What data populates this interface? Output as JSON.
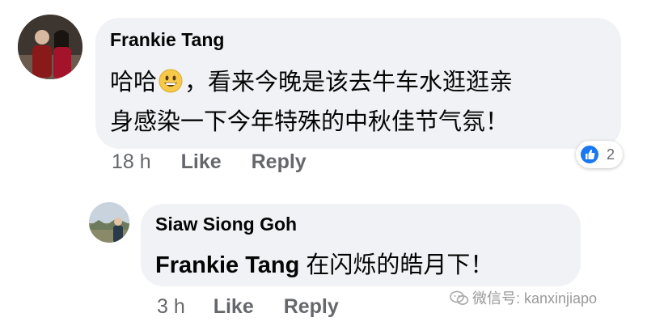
{
  "comment": {
    "author": "Frankie Tang",
    "text_line1_before_emoji": "哈哈",
    "text_line1_after_emoji": "，看来今晚是该去牛车水逛逛亲",
    "text_line2": "身感染一下今年特殊的中秋佳节气氛！",
    "time": "18 h",
    "like_label": "Like",
    "reply_label": "Reply",
    "reaction_count": "2",
    "emoji_icon": "grinning-face-emoji"
  },
  "reply": {
    "author": "Siaw Siong Goh",
    "mention": "Frankie Tang",
    "text": "在闪烁的皓月下！",
    "time": "3 h",
    "like_label": "Like",
    "reply_label": "Reply"
  },
  "watermark": {
    "text": "微信号: kanxinjiapo",
    "icon": "wechat-icon"
  },
  "colors": {
    "bubble": "#f0f2f5",
    "meta_text": "#65676b",
    "like_blue": "#1877f2"
  }
}
